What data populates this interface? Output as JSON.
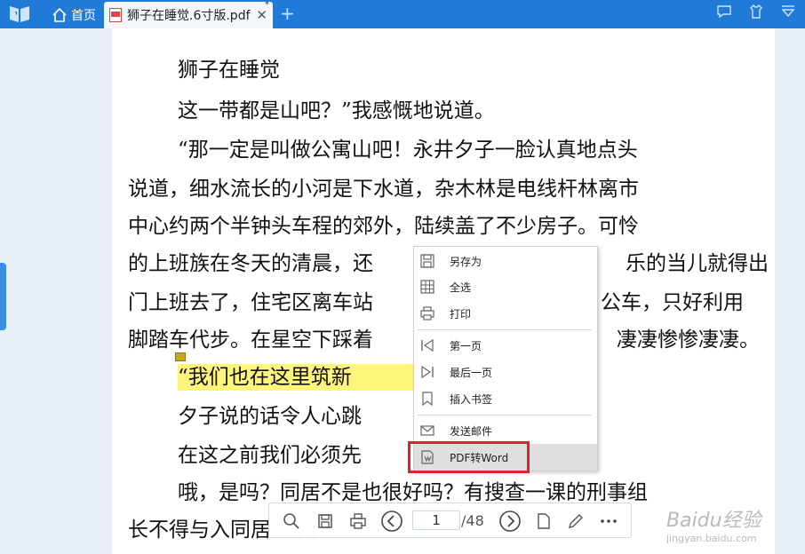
{
  "tabs": {
    "home_label": "首页",
    "doc_label": "狮子在睡觉.6寸版.pdf",
    "close_glyph": "✕",
    "modified_mark": "*",
    "add_glyph": "+"
  },
  "document": {
    "lines": [
      "狮子在睡觉",
      "这一带都是山吧？”我感慨地说道。",
      "“那一定是叫做公寓山吧！永井夕子一脸认真地点头",
      "说道，细水流长的小河是下水道，杂木林是电线杆林离市",
      "中心约两个半钟头车程的郊外，陆续盖了不少房子。可怜",
      "的上班族在冬天的清晨，还",
      "乐的当儿就得出",
      "门上班去了，住宅区离车站",
      "公车，只好利用",
      "脚踏车代步。在星空下踩着",
      "凄凄惨惨凄凄。",
      "“我们也在这里筑新",
      "夕子说的话令人心跳",
      "在这之前我们必须先",
      "哦，是吗？同居不是也很好吗？有搜查一课的刑事组",
      "长不得与入同居的规定吗？"
    ]
  },
  "context_menu": {
    "items": [
      {
        "label": "另存为",
        "icon": "save-icon"
      },
      {
        "label": "全选",
        "icon": "select-all-icon"
      },
      {
        "label": "打印",
        "icon": "print-icon"
      },
      {
        "label": "第一页",
        "icon": "first-page-icon"
      },
      {
        "label": "最后一页",
        "icon": "last-page-icon"
      },
      {
        "label": "插入书签",
        "icon": "bookmark-icon"
      },
      {
        "label": "发送邮件",
        "icon": "mail-icon"
      },
      {
        "label": "PDF转Word",
        "icon": "pdf-to-word-icon"
      }
    ]
  },
  "toolbar": {
    "current_page": "1",
    "total_pages": "/48"
  },
  "watermark": {
    "logo": "Baidu经验",
    "url": "jingyan.baidu.com"
  },
  "colors": {
    "tabbar": "#1f7ad8",
    "highlight": "#fff57a",
    "annotation_red": "#e0232a"
  }
}
